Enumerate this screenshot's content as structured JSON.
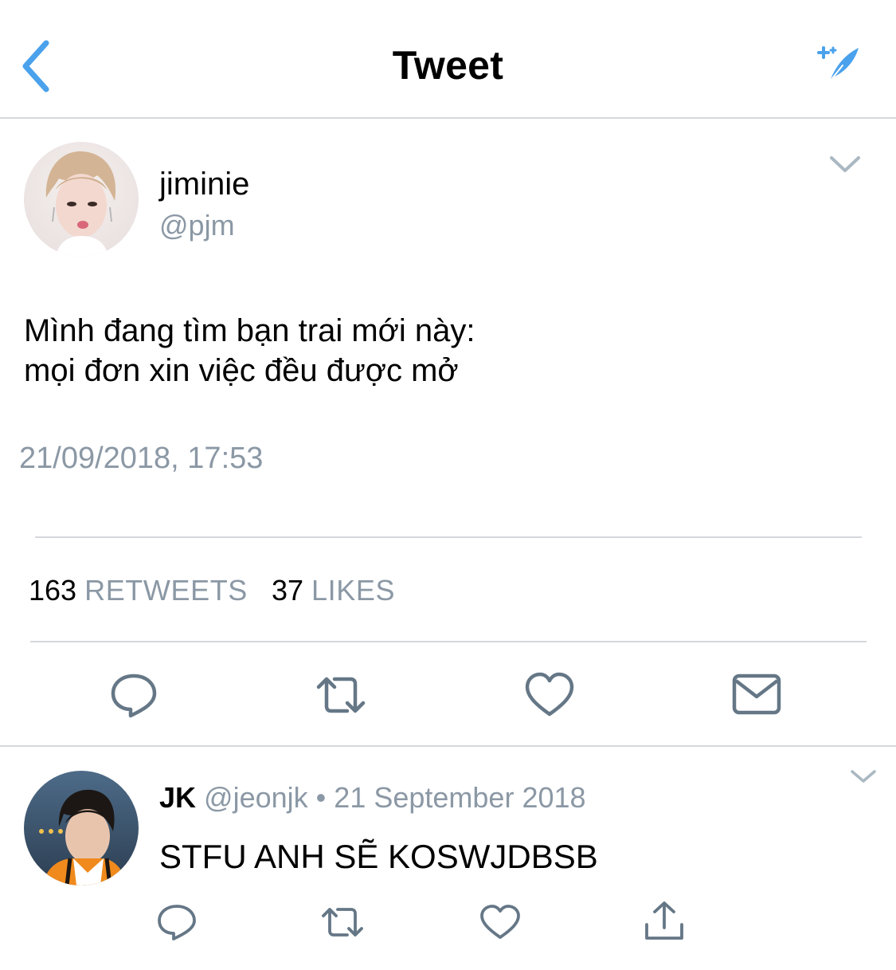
{
  "header": {
    "title": "Tweet",
    "back_icon": "chevron-left-icon",
    "compose_icon": "sparkle-feather-icon",
    "accent_color": "#4aa1ec"
  },
  "tweet": {
    "display_name": "jiminie",
    "handle": "@pjm",
    "text_line1": "Mình đang tìm bạn trai mới này:",
    "text_line2": "mọi đơn xin việc đều được mở",
    "timestamp": "21/09/2018, 17:53",
    "retweets_count": "163",
    "retweets_label": "RETWEETS",
    "likes_count": "37",
    "likes_label": "LIKES",
    "actions": [
      "reply-icon",
      "retweet-icon",
      "like-icon",
      "message-icon"
    ]
  },
  "reply": {
    "display_name": "JK",
    "handle": "@jeonjk",
    "separator": "•",
    "date": "21 September 2018",
    "text": "STFU ANH SẼ KOSWJDBSB",
    "actions": [
      "reply-icon",
      "retweet-icon",
      "like-icon",
      "share-icon"
    ]
  },
  "colors": {
    "secondary_text": "#8b98a5",
    "icon_gray": "#657786",
    "divider": "#d4d8dc"
  }
}
